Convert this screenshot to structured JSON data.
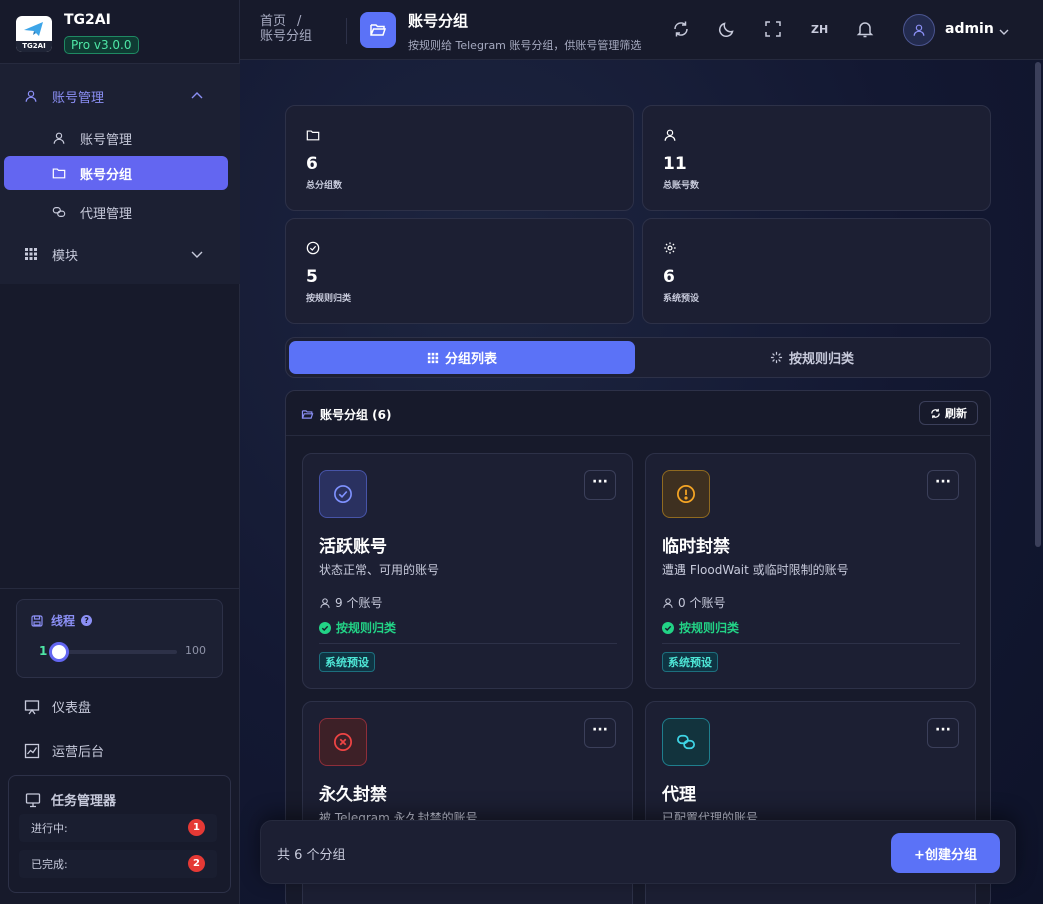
{
  "brand": {
    "name": "TG2AI",
    "version": "Pro v3.0.0",
    "logo_text": "TG2AI"
  },
  "sidebar": {
    "parent": {
      "label": "账号管理",
      "icon": "user-icon"
    },
    "items": [
      {
        "label": "账号管理",
        "icon": "user-icon"
      },
      {
        "label": "账号分组",
        "icon": "folder-icon"
      },
      {
        "label": "代理管理",
        "icon": "link-icon"
      }
    ],
    "modules_label": "模块",
    "thread": {
      "label": "线程",
      "value": 1,
      "max": "100",
      "min_display": "1"
    },
    "links": [
      {
        "label": "仪表盘",
        "icon": "presentation-icon"
      },
      {
        "label": "运营后台",
        "icon": "chart-icon"
      }
    ],
    "task_manager": {
      "title": "任务管理器",
      "rows": [
        {
          "label": "进行中:",
          "count": "1"
        },
        {
          "label": "已完成:",
          "count": "2"
        }
      ]
    }
  },
  "topbar": {
    "breadcrumb_home": "首页",
    "breadcrumb_sep": "/",
    "breadcrumb_current": "账号分组",
    "page_title": "账号分组",
    "page_subtitle": "按规则给 Telegram 账号分组，供账号管理筛选",
    "lang": "ZH",
    "username": "admin"
  },
  "stats": [
    {
      "value": "6",
      "label": "总分组数",
      "icon": "folder-icon"
    },
    {
      "value": "11",
      "label": "总账号数",
      "icon": "user-icon"
    },
    {
      "value": "5",
      "label": "按规则归类",
      "icon": "check-circle-icon"
    },
    {
      "value": "6",
      "label": "系统预设",
      "icon": "gear-icon"
    }
  ],
  "tabs": [
    {
      "label": "分组列表",
      "icon": "grid-icon"
    },
    {
      "label": "按规则归类",
      "icon": "sparkle-icon"
    }
  ],
  "panel": {
    "title": "账号分组 (6)",
    "refresh_label": "刷新"
  },
  "groups": [
    {
      "name": "活跃账号",
      "desc": "状态正常、可用的账号",
      "count": "9 个账号",
      "rule": "按规则归类",
      "tag": "系统预设",
      "icon": "check-circle-icon",
      "color": "#6b7ff5"
    },
    {
      "name": "临时封禁",
      "desc": "遭遇 FloodWait 或临时限制的账号",
      "count": "0 个账号",
      "rule": "按规则归类",
      "tag": "系统预设",
      "icon": "alert-circle-icon",
      "color": "#f59e0b"
    },
    {
      "name": "永久封禁",
      "desc": "被 Telegram 永久封禁的账号",
      "icon": "x-circle-icon",
      "color": "#ef4444"
    },
    {
      "name": "代理",
      "desc": "已配置代理的账号",
      "icon": "link-icon",
      "color": "#22c6d6"
    }
  ],
  "footer": {
    "total_text": "共 6 个分组",
    "create_label": "+创建分组"
  }
}
